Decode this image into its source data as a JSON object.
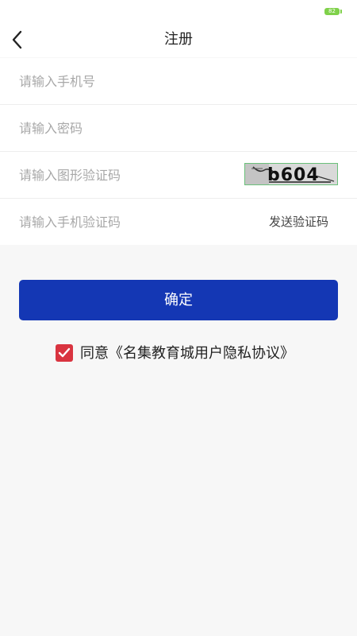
{
  "status_bar": {
    "battery": "82"
  },
  "header": {
    "title": "注册"
  },
  "form": {
    "phone": {
      "placeholder": "请输入手机号",
      "value": ""
    },
    "password": {
      "placeholder": "请输入密码",
      "value": ""
    },
    "captcha": {
      "placeholder": "请输入图形验证码",
      "value": "",
      "image_text": "b604"
    },
    "sms_code": {
      "placeholder": "请输入手机验证码",
      "value": "",
      "send_label": "发送验证码"
    }
  },
  "confirm_button": {
    "label": "确定"
  },
  "agreement": {
    "checked": true,
    "prefix": "同意",
    "link_text": "《名集教育城用户隐私协议》"
  },
  "colors": {
    "primary": "#1437b4",
    "checkbox": "#d93440",
    "battery": "#7fd14a"
  },
  "icons": {
    "back": "chevron-left-icon",
    "check": "checkmark-icon"
  }
}
